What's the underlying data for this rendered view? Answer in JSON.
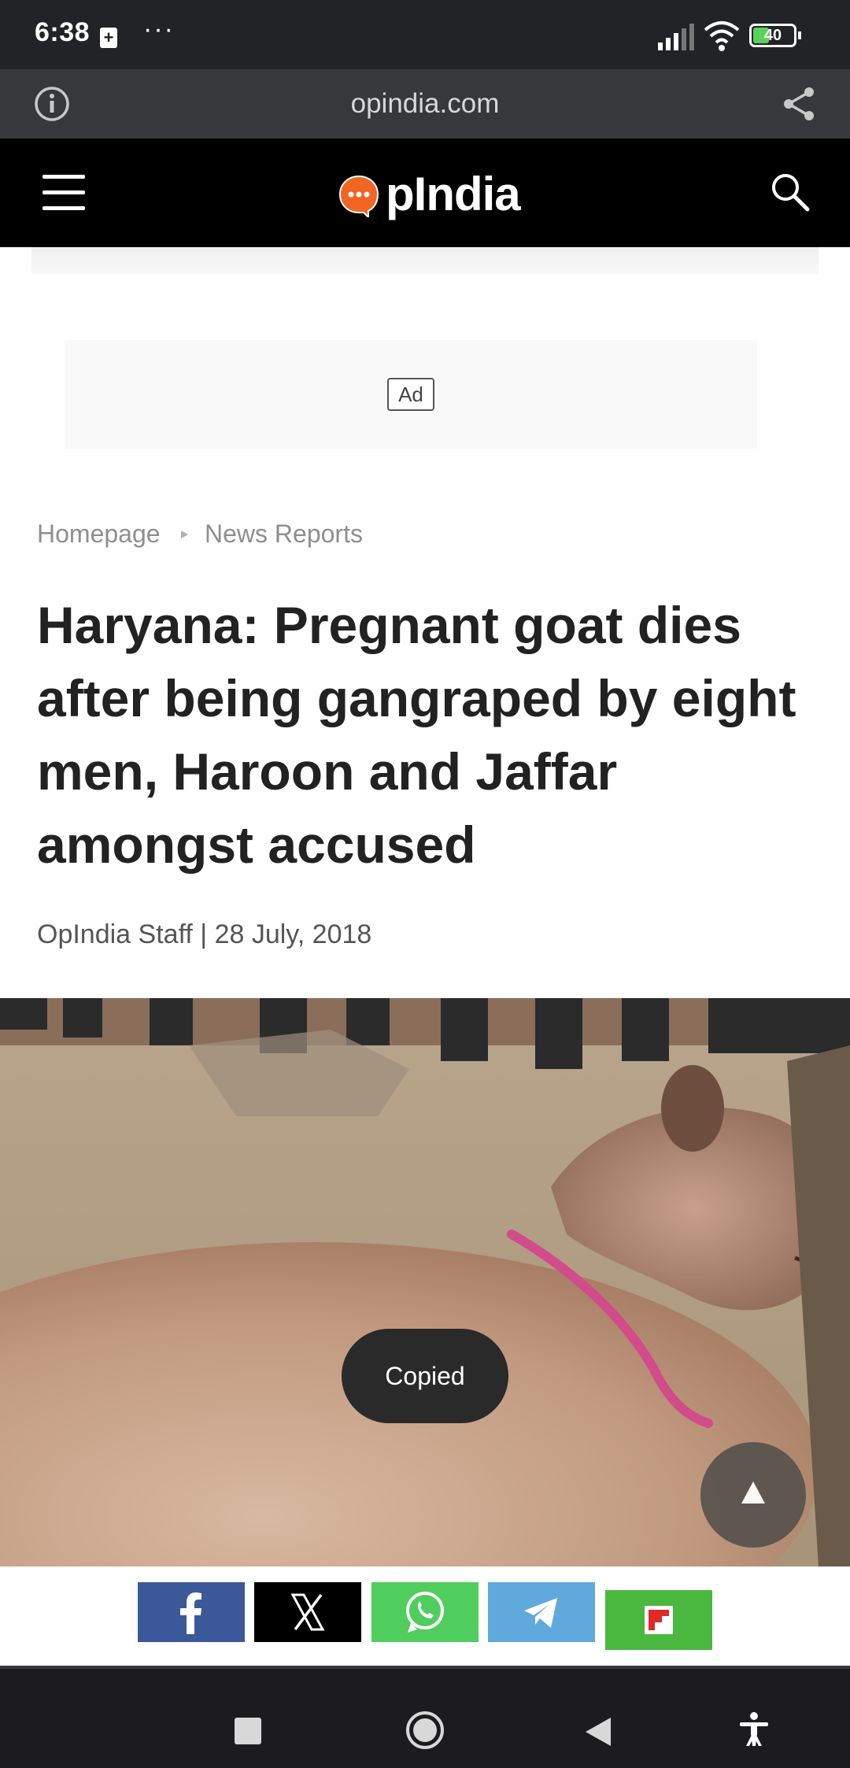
{
  "status_bar": {
    "time": "6:38",
    "battery": "40"
  },
  "browser": {
    "url": "opindia.com"
  },
  "site": {
    "logo_text": "pIndia"
  },
  "ad": {
    "label": "Ad"
  },
  "breadcrumb": {
    "home": "Homepage",
    "section": "News Reports"
  },
  "article": {
    "title": "Haryana: Pregnant goat dies after being gangraped by eight men, Haroon and Jaffar amongst accused",
    "byline": "OpIndia Staff | 28 July, 2018"
  },
  "toast": {
    "text": "Copied"
  },
  "share": {
    "buttons": [
      "facebook",
      "x",
      "whatsapp",
      "telegram",
      "flipboard"
    ],
    "colors": {
      "facebook": "#3b5998",
      "x": "#000000",
      "whatsapp": "#4fce5d",
      "telegram": "#5fa9dd",
      "flipboard": "#4ab83f"
    }
  },
  "colors": {
    "accent": "#f26522",
    "header_bg": "#000000"
  }
}
